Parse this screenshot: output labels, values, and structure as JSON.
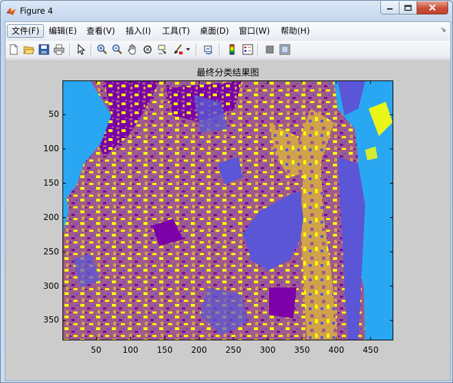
{
  "window": {
    "title": "Figure 4"
  },
  "menubar": {
    "items": [
      "文件(F)",
      "编辑(E)",
      "查看(V)",
      "插入(I)",
      "工具(T)",
      "桌面(D)",
      "窗口(W)",
      "帮助(H)"
    ]
  },
  "toolbar": {
    "icons": [
      "new-figure-icon",
      "open-file-icon",
      "save-icon",
      "print-icon",
      "select-arrow-icon",
      "zoom-in-icon",
      "zoom-out-icon",
      "pan-hand-icon",
      "rotate-3d-icon",
      "data-cursor-icon",
      "brush-icon",
      "link-plot-icon",
      "colorbar-icon",
      "legend-icon",
      "hide-plot-tools-icon",
      "show-plot-tools-icon"
    ]
  },
  "figure": {
    "title": "最终分类结果图",
    "yticks": [
      "50",
      "100",
      "150",
      "200",
      "250",
      "300",
      "350"
    ],
    "xticks": [
      "50",
      "100",
      "150",
      "200",
      "250",
      "300",
      "350",
      "400",
      "450"
    ]
  },
  "colors": {
    "class_sky_blue": "#2aa7f2",
    "class_purple": "#7b00a8",
    "class_mauve": "#a05a8c",
    "class_yellow": "#ffff00",
    "class_gold": "#d1a24c",
    "class_slate_blue": "#5a56d6"
  }
}
